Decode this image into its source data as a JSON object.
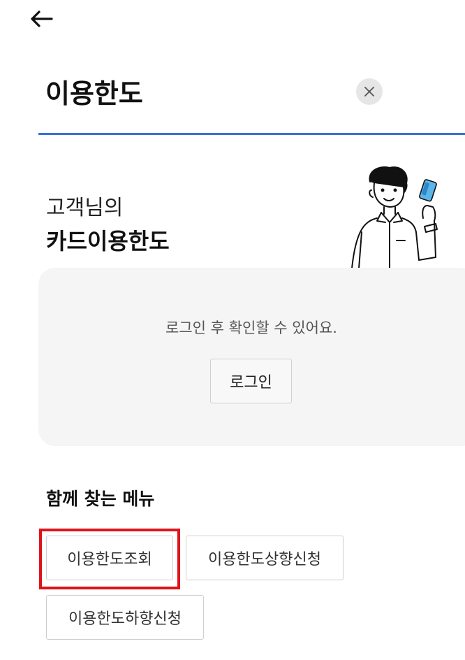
{
  "header": {
    "back_icon": "arrow-left-icon"
  },
  "search": {
    "value": "이용한도",
    "clear_icon": "close-icon"
  },
  "greeting": {
    "line1": "고객님의",
    "line2": "카드이용한도"
  },
  "login_panel": {
    "message": "로그인 후 확인할 수 있어요.",
    "button_label": "로그인"
  },
  "related_menu": {
    "title": "함께 찾는 메뉴",
    "items": [
      {
        "label": "이용한도조회",
        "highlighted": true
      },
      {
        "label": "이용한도상향신청",
        "highlighted": false
      },
      {
        "label": "이용한도하향신청",
        "highlighted": false
      }
    ]
  },
  "colors": {
    "accent_line": "#3b6fd8",
    "highlight_box": "#e0131a",
    "panel_bg": "#f5f5f6"
  }
}
